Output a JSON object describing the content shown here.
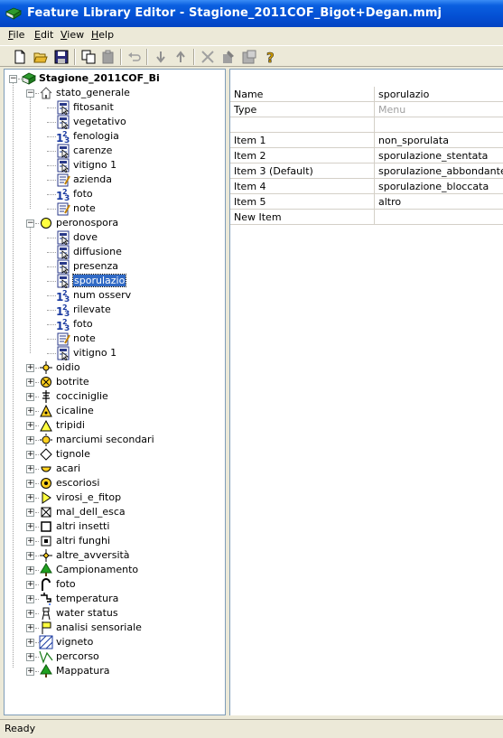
{
  "window": {
    "title": "Feature Library Editor - Stagione_2011COF_Bigot+Degan.mmj"
  },
  "menu": [
    {
      "label": "File",
      "accel": "F",
      "rest": "ile"
    },
    {
      "label": "Edit",
      "accel": "E",
      "rest": "dit"
    },
    {
      "label": "View",
      "accel": "V",
      "rest": "iew"
    },
    {
      "label": "Help",
      "accel": "H",
      "rest": "elp"
    }
  ],
  "toolbar": {
    "buttons": [
      "new-icon",
      "open-icon",
      "save-icon",
      "copy-icon",
      "paste-icon",
      "undo-icon",
      "move-down-icon",
      "move-up-icon",
      "delete-icon",
      "properties-icon",
      "export-icon",
      "help-icon"
    ]
  },
  "tree": {
    "root": "Stagione_2011COF_Bi",
    "groups": [
      {
        "label": "stato_generale",
        "icon": "home-icon",
        "expanded": true,
        "children": [
          {
            "label": "fitosanit",
            "icon": "menu-icon"
          },
          {
            "label": "vegetativo",
            "icon": "menu-icon"
          },
          {
            "label": "fenologia",
            "icon": "numeric-icon"
          },
          {
            "label": "carenze",
            "icon": "menu-icon"
          },
          {
            "label": "vitigno 1",
            "icon": "menu-icon"
          },
          {
            "label": "azienda",
            "icon": "text-icon"
          },
          {
            "label": "foto",
            "icon": "numeric-icon"
          },
          {
            "label": "note",
            "icon": "text-icon"
          }
        ]
      },
      {
        "label": "peronospora",
        "icon": "yellow-circle-icon",
        "expanded": true,
        "children": [
          {
            "label": "dove",
            "icon": "menu-icon"
          },
          {
            "label": "diffusione",
            "icon": "menu-icon"
          },
          {
            "label": "presenza",
            "icon": "menu-icon"
          },
          {
            "label": "sporulazio",
            "icon": "menu-icon",
            "selected": true
          },
          {
            "label": "num osserv",
            "icon": "numeric-icon"
          },
          {
            "label": "rilevate",
            "icon": "numeric-icon"
          },
          {
            "label": "foto",
            "icon": "numeric-icon"
          },
          {
            "label": "note",
            "icon": "text-icon"
          },
          {
            "label": "vitigno 1",
            "icon": "menu-icon"
          }
        ]
      },
      {
        "label": "oidio",
        "icon": "crosshair-icon"
      },
      {
        "label": "botrite",
        "icon": "x-circle-icon"
      },
      {
        "label": "cocciniglie",
        "icon": "pole-icon"
      },
      {
        "label": "cicaline",
        "icon": "warning-triangle-icon"
      },
      {
        "label": "tripidi",
        "icon": "triangle-icon"
      },
      {
        "label": "marciumi secondari",
        "icon": "sun-circle-icon"
      },
      {
        "label": "tignole",
        "icon": "diamond-icon"
      },
      {
        "label": "acari",
        "icon": "half-circle-icon"
      },
      {
        "label": "escoriosi",
        "icon": "target-icon"
      },
      {
        "label": "virosi_e_fitop",
        "icon": "flag-right-icon"
      },
      {
        "label": "mal_dell_esca",
        "icon": "x-square-icon"
      },
      {
        "label": "altri insetti",
        "icon": "square-icon"
      },
      {
        "label": "altri funghi",
        "icon": "dot-square-icon"
      },
      {
        "label": "altre_avversità",
        "icon": "plus-diamond-icon"
      },
      {
        "label": "Campionamento",
        "icon": "tree-icon"
      },
      {
        "label": "foto",
        "icon": "camera-icon"
      },
      {
        "label": "temperatura",
        "icon": "tap-icon"
      },
      {
        "label": "water status",
        "icon": "tower-icon"
      },
      {
        "label": "analisi sensoriale",
        "icon": "yellow-flag-icon"
      },
      {
        "label": "vigneto",
        "icon": "hatched-area-icon"
      },
      {
        "label": "percorso",
        "icon": "polyline-icon"
      },
      {
        "label": "Mappatura",
        "icon": "tree-icon"
      }
    ]
  },
  "properties": {
    "rows": [
      {
        "key": "Name",
        "value": "sporulazio"
      },
      {
        "key": "Type",
        "value": "Menu",
        "disabled": true
      },
      {
        "key": "",
        "value": ""
      },
      {
        "key": "Item 1",
        "value": "non_sporulata"
      },
      {
        "key": "Item 2",
        "value": "sporulazione_stentata"
      },
      {
        "key": "Item 3  (Default)",
        "value": "sporulazione_abbondante"
      },
      {
        "key": "Item 4",
        "value": "sporulazione_bloccata"
      },
      {
        "key": "Item 5",
        "value": "altro"
      },
      {
        "key": "New Item",
        "value": ""
      }
    ]
  },
  "status": {
    "text": "Ready"
  }
}
